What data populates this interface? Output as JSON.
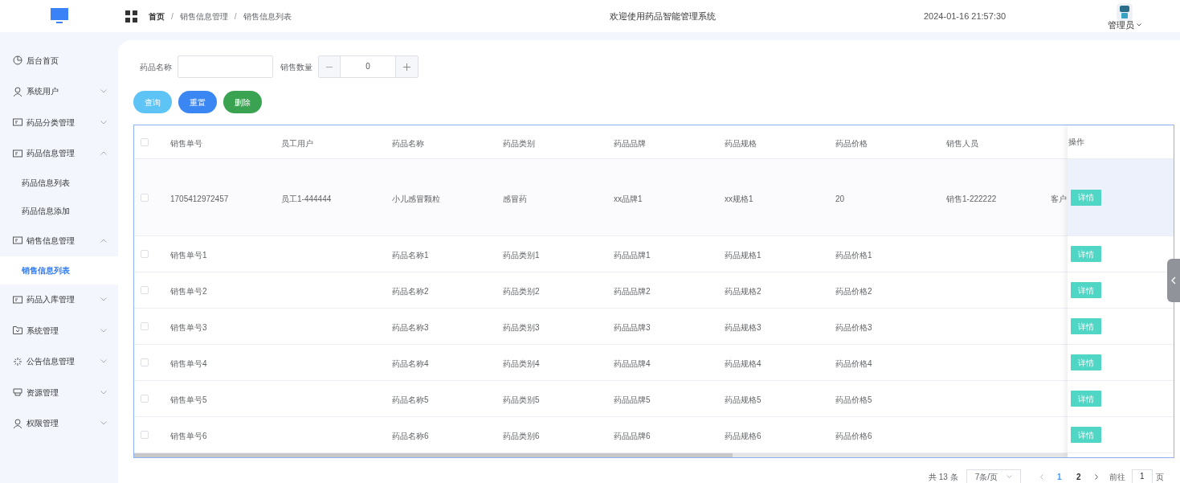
{
  "header": {
    "breadcrumb": [
      "首页",
      "销售信息管理",
      "销售信息列表"
    ],
    "separator": "/",
    "title": "欢迎使用药品智能管理系统",
    "datetime": "2024-01-16 21:57:30",
    "user": "管理员"
  },
  "sidebar": {
    "items": [
      {
        "label": "后台首页",
        "selected": false
      },
      {
        "label": "系统用户",
        "selected": false,
        "expanded": false
      },
      {
        "label": "药品分类管理",
        "selected": false,
        "expanded": false
      },
      {
        "label": "药品信息管理",
        "selected": false,
        "expanded": true,
        "children": [
          {
            "label": "药品信息列表",
            "selected": false
          },
          {
            "label": "药品信息添加",
            "selected": false
          }
        ]
      },
      {
        "label": "销售信息管理",
        "selected": false,
        "expanded": true,
        "children": [
          {
            "label": "销售信息列表",
            "selected": true
          }
        ]
      },
      {
        "label": "药品入库管理",
        "selected": false,
        "expanded": false
      },
      {
        "label": "系统管理",
        "selected": false,
        "expanded": false
      },
      {
        "label": "公告信息管理",
        "selected": false,
        "expanded": false
      },
      {
        "label": "资源管理",
        "selected": false,
        "expanded": false
      },
      {
        "label": "权限管理",
        "selected": false,
        "expanded": false
      }
    ]
  },
  "search": {
    "name_label": "药品名称",
    "quantity_label": "销售数量",
    "quantity_value": "0"
  },
  "buttons": [
    {
      "label": "查询",
      "kind": "info"
    },
    {
      "label": "重置",
      "kind": "primary"
    },
    {
      "label": "删除",
      "kind": "success"
    }
  ],
  "table": {
    "all_checked": false,
    "columns": [
      "销售单号",
      "员工用户",
      "药品名称",
      "药品类别",
      "药品品牌",
      "药品规格",
      "药品价格",
      "销售人员"
    ],
    "action_column": "操作",
    "rows": [
      {
        "checked": false,
        "hovered": true,
        "cells": [
          "1705412972457",
          "员工1-444444",
          "小儿感冒颗粒",
          "感冒药",
          "xx品牌1",
          "xx规格1",
          "20",
          "销售1-222222",
          "客户"
        ],
        "action": "详情"
      },
      {
        "checked": false,
        "hovered": false,
        "cells": [
          "销售单号1",
          "",
          "药品名称1",
          "药品类别1",
          "药品品牌1",
          "药品规格1",
          "药品价格1",
          ""
        ],
        "action": "详情"
      },
      {
        "checked": false,
        "hovered": false,
        "cells": [
          "销售单号2",
          "",
          "药品名称2",
          "药品类别2",
          "药品品牌2",
          "药品规格2",
          "药品价格2",
          ""
        ],
        "action": "详情"
      },
      {
        "checked": false,
        "hovered": false,
        "cells": [
          "销售单号3",
          "",
          "药品名称3",
          "药品类别3",
          "药品品牌3",
          "药品规格3",
          "药品价格3",
          ""
        ],
        "action": "详情"
      },
      {
        "checked": false,
        "hovered": false,
        "cells": [
          "销售单号4",
          "",
          "药品名称4",
          "药品类别4",
          "药品品牌4",
          "药品规格4",
          "药品价格4",
          ""
        ],
        "action": "详情"
      },
      {
        "checked": false,
        "hovered": false,
        "cells": [
          "销售单号5",
          "",
          "药品名称5",
          "药品类别5",
          "药品品牌5",
          "药品规格5",
          "药品价格5",
          ""
        ],
        "action": "详情"
      },
      {
        "checked": false,
        "hovered": false,
        "cells": [
          "销售单号6",
          "",
          "药品名称6",
          "药品类别6",
          "药品品牌6",
          "药品规格6",
          "药品价格6",
          ""
        ],
        "action": "详情"
      }
    ]
  },
  "pagination": {
    "total": "共 13 条",
    "page_size": "7条/页",
    "pages": [
      {
        "label": "1",
        "selected": true
      },
      {
        "label": "2",
        "selected": false
      }
    ],
    "goto_label": "前往",
    "goto_value": "1",
    "goto_suffix": "页"
  }
}
